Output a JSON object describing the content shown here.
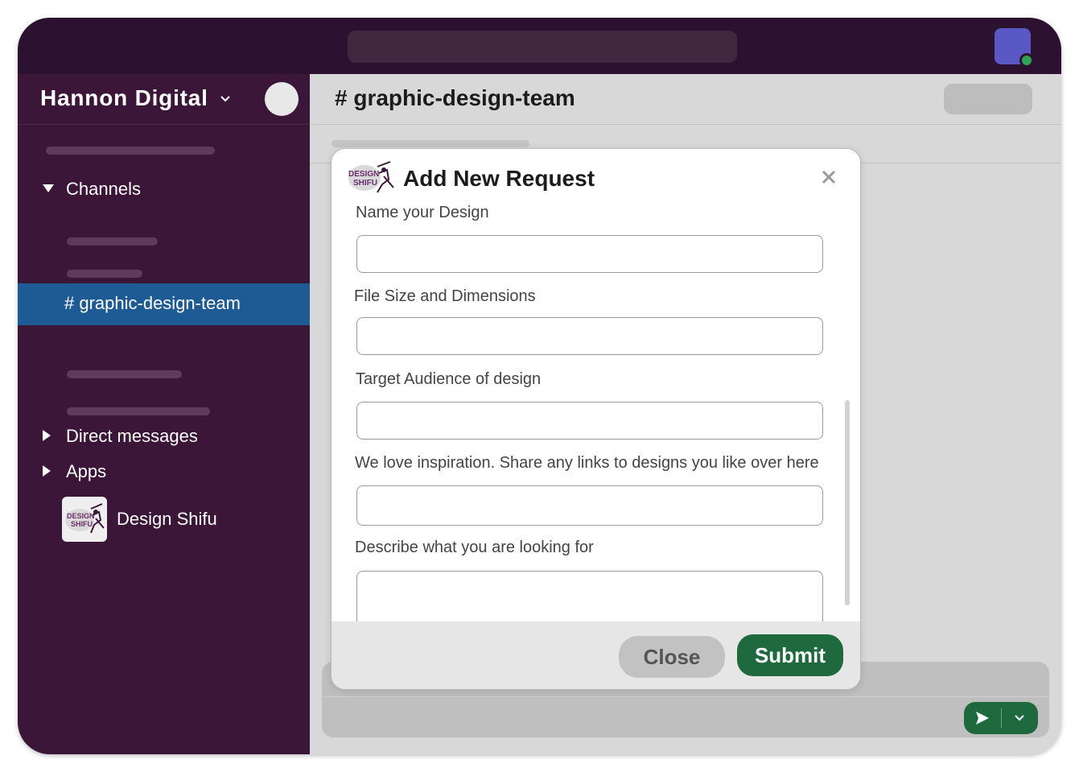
{
  "workspace": {
    "name": "Hannon Digital"
  },
  "sidebar": {
    "sections": {
      "channels": "Channels",
      "direct_messages": "Direct messages",
      "apps": "Apps"
    },
    "active_channel": "# graphic-design-team",
    "app_item": "Design Shifu"
  },
  "channel": {
    "title": "# graphic-design-team"
  },
  "modal": {
    "title": "Add New Request",
    "fields": [
      {
        "label": "Name your Design",
        "value": ""
      },
      {
        "label": "File Size and Dimensions",
        "value": ""
      },
      {
        "label": "Target Audience of design",
        "value": ""
      },
      {
        "label": "We love inspiration. Share any links to designs you like over here",
        "value": ""
      },
      {
        "label": "Describe what you are looking for",
        "value": ""
      }
    ],
    "close_label": "Close",
    "submit_label": "Submit",
    "logo_text": [
      "DESIGN",
      "SHIFU"
    ]
  },
  "colors": {
    "sidebar_bg": "#3b1639",
    "topbar_bg": "#2c1130",
    "active_channel_bg": "#1e5b94",
    "submit_bg": "#1e6a3e",
    "presence": "#2fa353"
  },
  "icons": {
    "workspace_chevron": "chevron-down-icon",
    "close": "close-icon",
    "send": "send-icon",
    "caret_expanded": "caret-down-icon",
    "caret_collapsed": "caret-right-icon"
  }
}
